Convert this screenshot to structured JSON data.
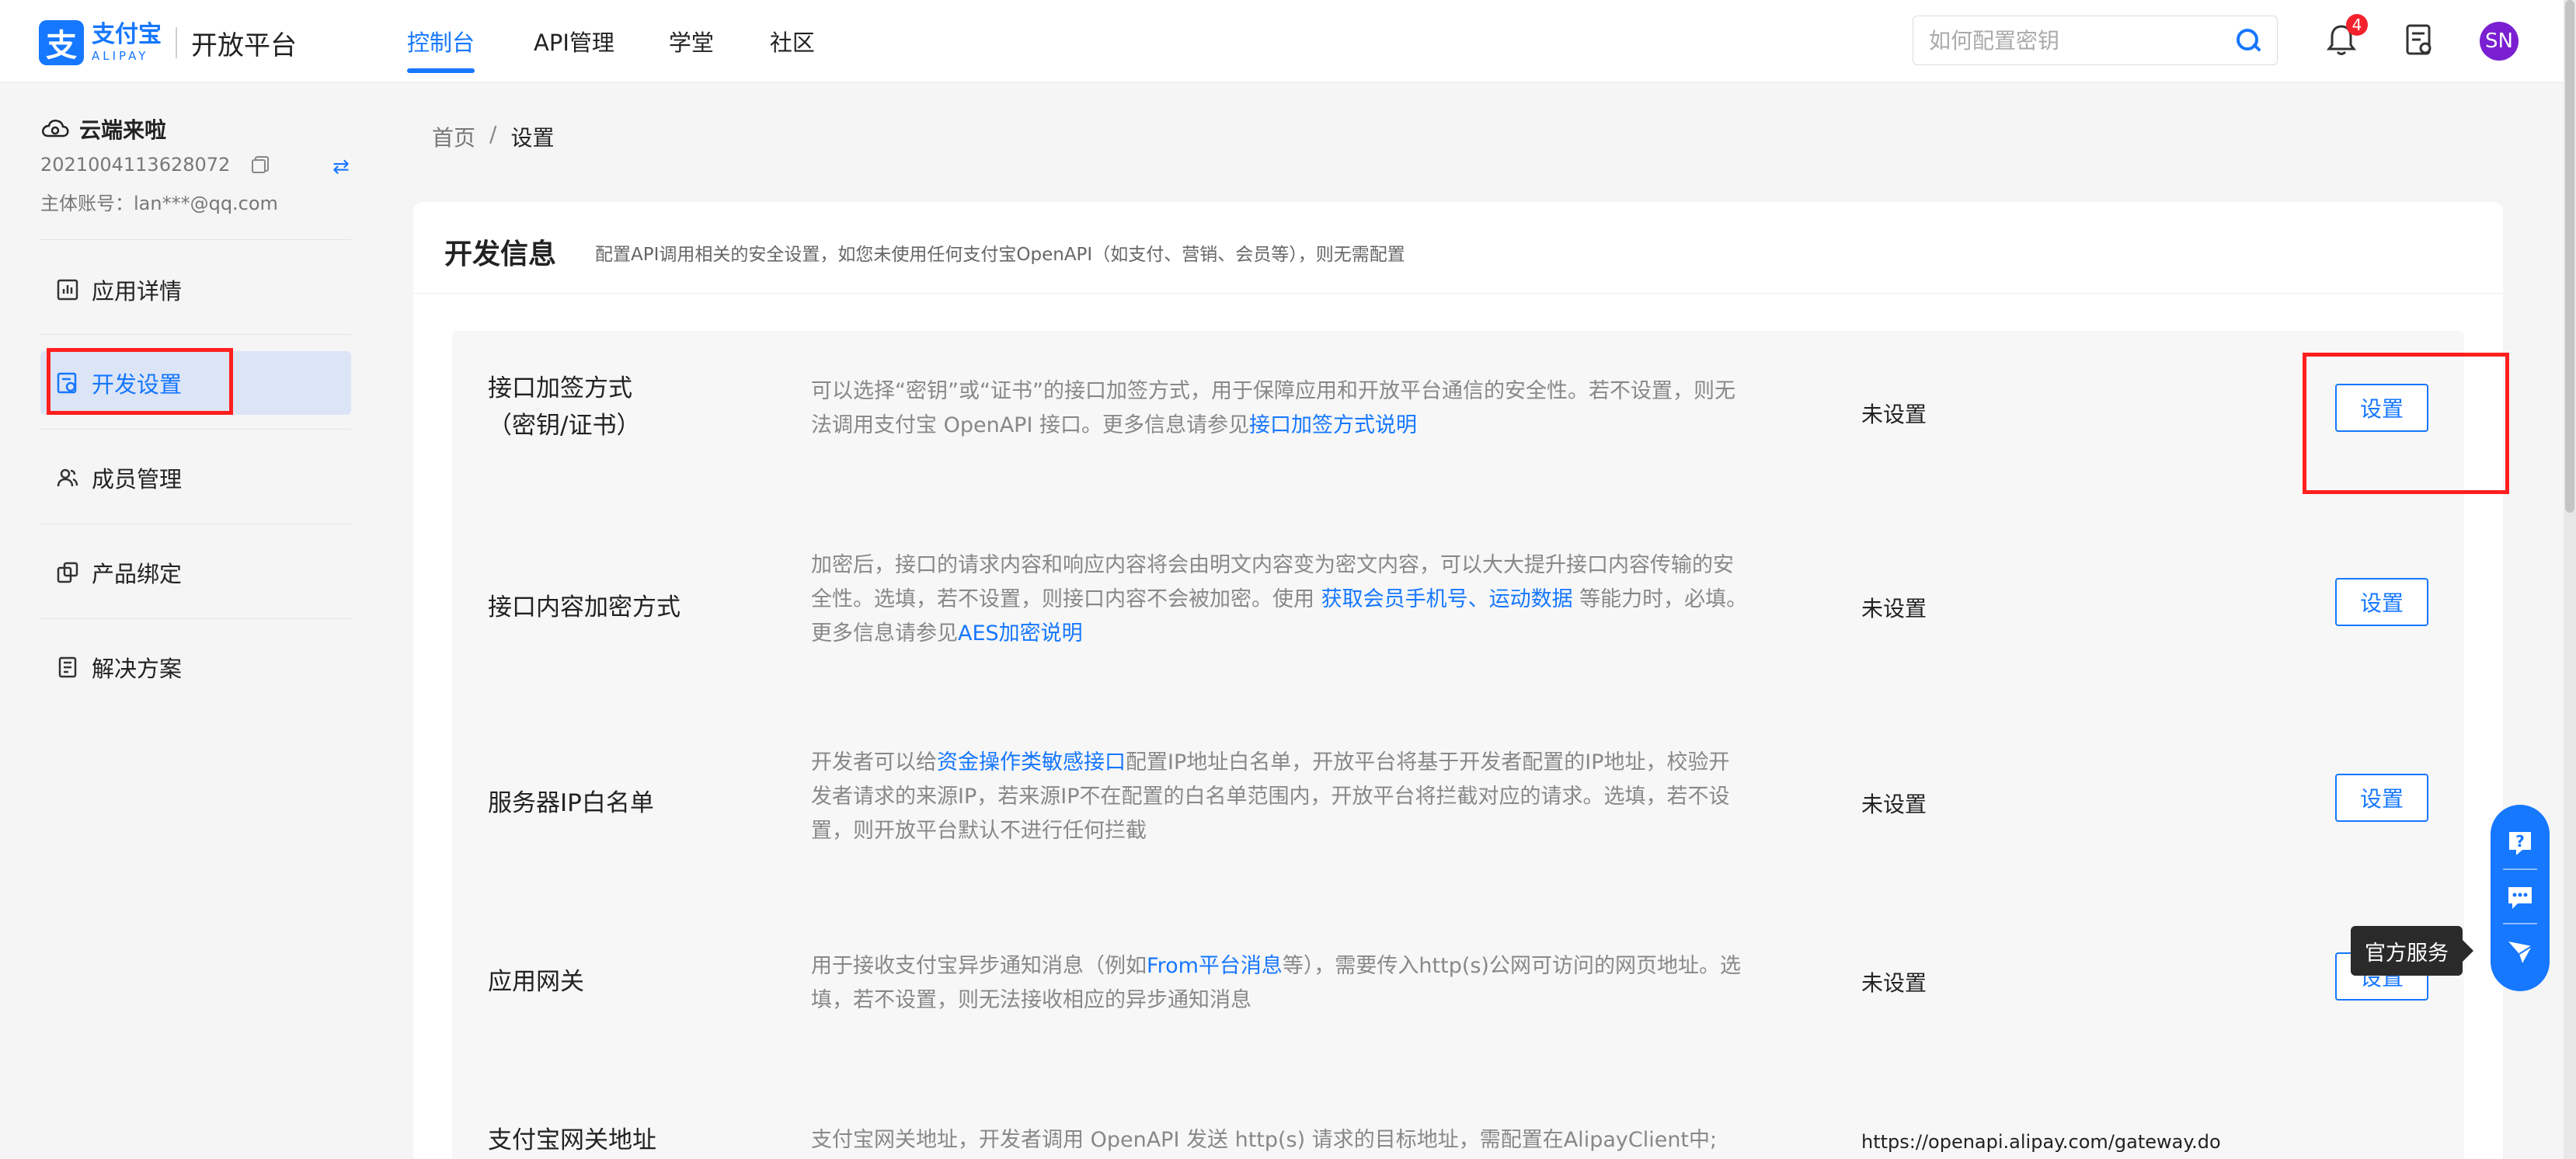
{
  "header": {
    "logo_mark": "支",
    "logo_cn": "支付宝",
    "logo_en": "ALIPAY",
    "platform": "开放平台",
    "nav": [
      {
        "label": "控制台",
        "active": true
      },
      {
        "label": "API管理",
        "active": false
      },
      {
        "label": "学堂",
        "active": false
      },
      {
        "label": "社区",
        "active": false
      }
    ],
    "search_placeholder": "如何配置密钥",
    "notification_count": "4",
    "avatar": "SN"
  },
  "sidebar": {
    "app_name": "云端来啦",
    "app_id": "2021004113628072",
    "swap_icon": "⇄",
    "account": "主体账号：lan***@qq.com",
    "items": [
      {
        "label": "应用详情",
        "icon": "chart-icon",
        "active": false
      },
      {
        "label": "开发设置",
        "icon": "settings-doc-icon",
        "active": true
      },
      {
        "label": "成员管理",
        "icon": "members-icon",
        "active": false
      },
      {
        "label": "产品绑定",
        "icon": "link-icon",
        "active": false
      },
      {
        "label": "解决方案",
        "icon": "solution-icon",
        "active": false
      }
    ]
  },
  "breadcrumb": {
    "home": "首页",
    "separator": "/",
    "current": "设置"
  },
  "card": {
    "title": "开发信息",
    "desc": "配置API调用相关的安全设置，如您未使用任何支付宝OpenAPI（如支付、营销、会员等），则无需配置"
  },
  "rows": [
    {
      "label_1": "接口加签方式",
      "label_2": "（密钥/证书）",
      "desc_1": "可以选择“密钥”或“证书”的接口加签方式，用于保障应用和开放平台通信的安全性。若不设置，则无",
      "desc_2": "法调用支付宝 OpenAPI 接口。更多信息请参见",
      "link": "接口加签方式说明",
      "status": "未设置",
      "button": "设置"
    },
    {
      "label": "接口内容加密方式",
      "desc_1": "加密后，接口的请求内容和响应内容将会由明文内容变为密文内容，可以大大提升接口内容传输的安",
      "desc_2a": "全性。选填，若不设置，则接口内容不会被加密。使用 ",
      "link_a": "获取会员手机号",
      "sep": "、",
      "link_b": "运动数据",
      "desc_2b": " 等能力时，必填。",
      "desc_3": "更多信息请参见",
      "link_c": "AES加密说明",
      "status": "未设置",
      "button": "设置"
    },
    {
      "label": "服务器IP白名单",
      "desc_1a": "开发者可以给",
      "link": "资金操作类敏感接口",
      "desc_1b": "配置IP地址白名单，开放平台将基于开发者配置的IP地址，校验开",
      "desc_2": "发者请求的来源IP，若来源IP不在配置的白名单范围内，开放平台将拦截对应的请求。选填，若不设",
      "desc_3": "置，则开放平台默认不进行任何拦截",
      "status": "未设置",
      "button": "设置"
    },
    {
      "label": "应用网关",
      "desc_1a": "用于接收支付宝异步通知消息（例如",
      "link": "From平台消息",
      "desc_1b": "等），需要传入http(s)公网可访问的网页地址。选",
      "desc_2": "填，若不设置，则无法接收相应的异步通知消息",
      "status": "未设置",
      "button": "设置"
    },
    {
      "label": "支付宝网关地址",
      "desc": "支付宝网关地址，开发者调用 OpenAPI 发送 http(s) 请求的目标地址，需配置在AlipayClient中;",
      "url": "https://openapi.alipay.com/gateway.do"
    }
  ],
  "float_service": {
    "tooltip": "官方服务",
    "icons": [
      "help-icon",
      "chat-icon",
      "service-icon"
    ]
  },
  "colors": {
    "accent": "#1677ff",
    "highlight": "#ff1f1f",
    "avatar": "#7a1fd1"
  }
}
